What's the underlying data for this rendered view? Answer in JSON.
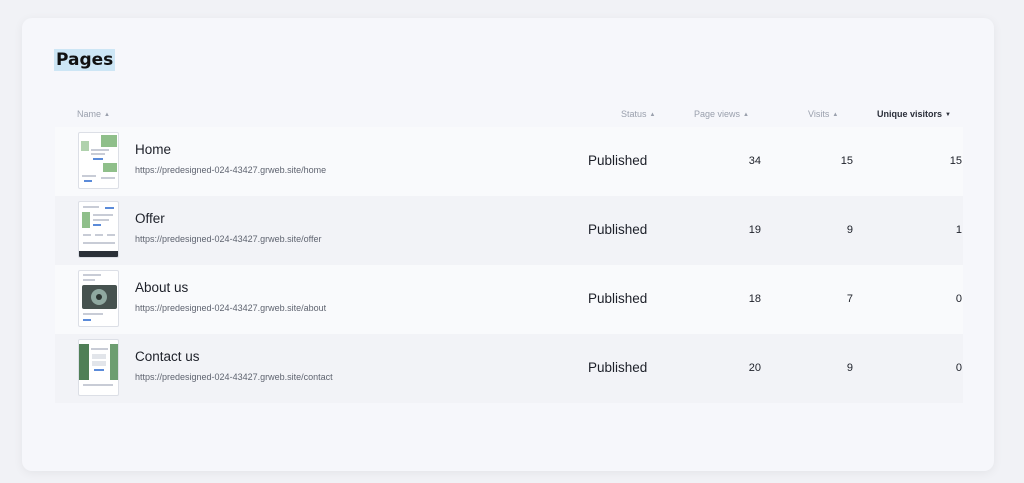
{
  "page": {
    "title": "Pages"
  },
  "columns": {
    "name": "Name",
    "status": "Status",
    "page_views": "Page views",
    "visits": "Visits",
    "unique_visitors": "Unique visitors"
  },
  "rows": [
    {
      "name": "Home",
      "url": "https://predesigned-024-43427.grweb.site/home",
      "status": "Published",
      "page_views": "34",
      "visits": "15",
      "unique_visitors": "15"
    },
    {
      "name": "Offer",
      "url": "https://predesigned-024-43427.grweb.site/offer",
      "status": "Published",
      "page_views": "19",
      "visits": "9",
      "unique_visitors": "1"
    },
    {
      "name": "About us",
      "url": "https://predesigned-024-43427.grweb.site/about",
      "status": "Published",
      "page_views": "18",
      "visits": "7",
      "unique_visitors": "0"
    },
    {
      "name": "Contact us",
      "url": "https://predesigned-024-43427.grweb.site/contact",
      "status": "Published",
      "page_views": "20",
      "visits": "9",
      "unique_visitors": "0"
    }
  ],
  "colors": {
    "highlight": "#cde6f5",
    "card_background": "#f6f7fb",
    "page_background": "#f1f2f6"
  },
  "sort": {
    "active_column": "unique_visitors",
    "active_direction": "descending",
    "caret_up_icon": "caret-up-icon",
    "caret_down_icon": "caret-down-icon"
  }
}
